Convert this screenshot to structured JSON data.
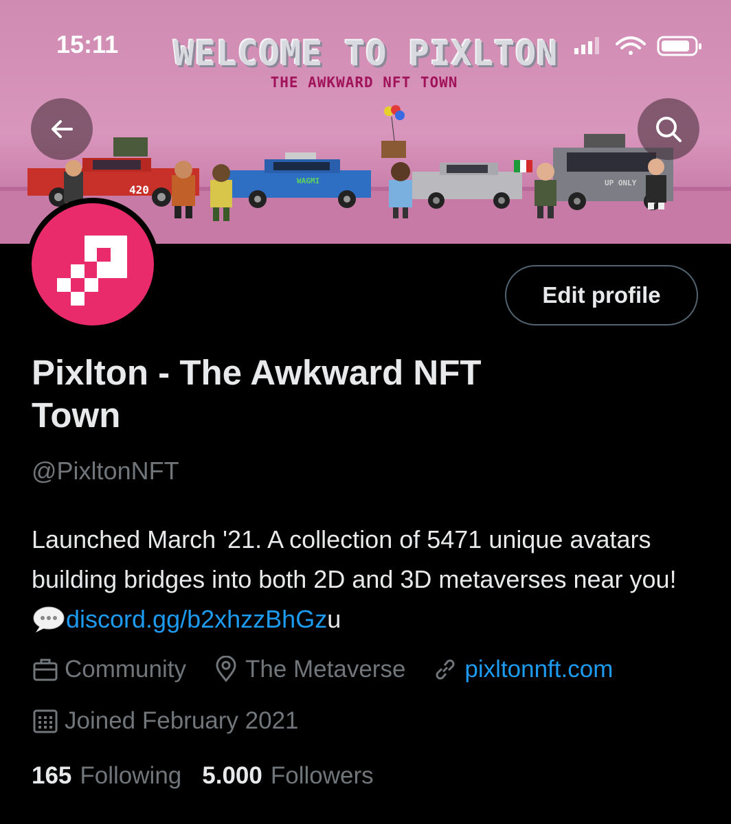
{
  "status_bar": {
    "time": "15:11"
  },
  "banner": {
    "title": "WELCOME TO PIXLTON",
    "subtitle": "THE AWKWARD NFT TOWN",
    "car_labels": [
      "420",
      "WAGMI",
      "UP ONLY"
    ],
    "colors": {
      "sky": "#d996bd",
      "ground": "#c77aa6",
      "subtitle": "#a0135a"
    }
  },
  "nav": {
    "back_icon": "arrow-left-icon",
    "search_icon": "search-icon"
  },
  "profile": {
    "avatar_color": "#ea2b6b",
    "edit_button": "Edit profile",
    "name": "Pixlton - The Awkward NFT Town",
    "handle": "@PixltonNFT",
    "bio_text": "Launched March '21. A collection of 5471 unique avatars building bridges into both 2D and 3D metaverses near you! ",
    "bio_link": "discord.gg/b2xhzzBhGz",
    "bio_tail": "u",
    "category": "Community",
    "location": "The Metaverse",
    "website": "pixltonnft.com",
    "joined": "Joined February 2021",
    "following_count": "165",
    "following_label": "Following",
    "followers_count": "5.000",
    "followers_label": "Followers"
  },
  "colors": {
    "accent_link": "#1d9bf0",
    "secondary_text": "#71767b",
    "primary_text": "#e7e9ea",
    "background": "#000000"
  }
}
